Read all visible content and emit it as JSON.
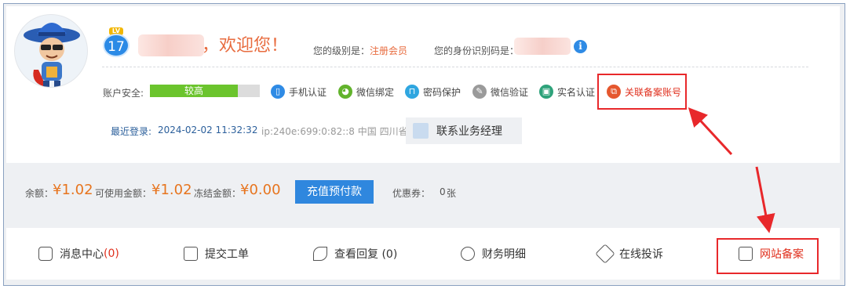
{
  "user": {
    "level_badge": "LV",
    "level_num": "17",
    "welcome": "，欢迎您！",
    "level_label": "您的级别是：",
    "level_value": "注册会员",
    "id_label": "您的身份识别码是：",
    "info_icon": "i"
  },
  "security": {
    "label": "账户安全:",
    "level_text": "较高",
    "level_fraction": 0.8,
    "items": [
      {
        "label": "手机认证",
        "icon": "phone-icon",
        "color": "#2f8be5",
        "glyph": "▯"
      },
      {
        "label": "微信绑定",
        "icon": "wechat-icon",
        "color": "#62b32c",
        "glyph": "◕"
      },
      {
        "label": "密码保护",
        "icon": "lock-icon",
        "color": "#2fa6e0",
        "glyph": "⊓"
      },
      {
        "label": "微信验证",
        "icon": "wrench-icon",
        "color": "#9a9a9a",
        "glyph": "✎"
      },
      {
        "label": "实名认证",
        "icon": "id-card-icon",
        "color": "#2ea27a",
        "glyph": "▣"
      },
      {
        "label": "关联备案账号",
        "icon": "link-account-icon",
        "color": "#e5572e",
        "glyph": "⧉"
      }
    ]
  },
  "login": {
    "label": "最近登录:",
    "time": "2024-02-02 11:32:32",
    "ip": "ip:240e:699:0:82::8  中国 四川省",
    "contact": "联系业务经理"
  },
  "balance": {
    "balance_label": "余额：",
    "balance_value": "¥1.02",
    "available_label": "可使用金额：",
    "available_value": "¥1.02",
    "frozen_label": "冻结金额：",
    "frozen_value": "¥0.00",
    "recharge": "充值预付款",
    "coupon_label": "优惠券：",
    "coupon_num": "0",
    "coupon_unit": "张"
  },
  "nav": {
    "messages": "消息中心",
    "messages_count": "(0)",
    "ticket": "提交工单",
    "replies": "查看回复 (0)",
    "finance": "财务明细",
    "complaint": "在线投诉",
    "icp": "网站备案"
  },
  "colors": {
    "accent": "#2f87de",
    "orange": "#e86b3e",
    "highlight_red": "#e8282b",
    "security_green": "#6bc42d"
  }
}
